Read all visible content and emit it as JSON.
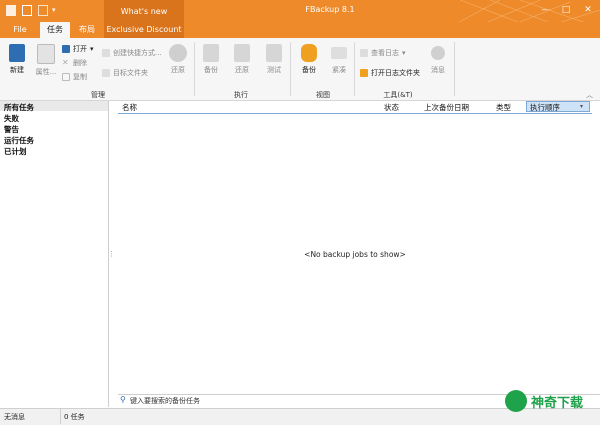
{
  "window": {
    "title": "FBackup 8.1",
    "minimize": "—",
    "maximize": "□",
    "close": "✕"
  },
  "tabs": {
    "file": "File",
    "task": "任务",
    "layout": "布局",
    "whats_new": "What's new",
    "discount": "Exclusive Discount"
  },
  "ribbon": {
    "manage": {
      "caption": "管理",
      "new": "新建",
      "properties": "属性...",
      "open": "打开",
      "delete": "删除",
      "copy": "复制",
      "create_shortcut": "创建快捷方式...",
      "target_folder": "目标文件夹",
      "restore": "还原"
    },
    "execute": {
      "caption": "执行",
      "backup": "备份",
      "restore": "还原",
      "test": "测试"
    },
    "view": {
      "caption": "视图",
      "backup": "备份",
      "compact": "紧凑"
    },
    "tools": {
      "caption": "工具(&T)",
      "view_log": "查看日志",
      "open_log_folder": "打开日志文件夹",
      "messages": "消息"
    }
  },
  "nav": [
    "所有任务",
    "失败",
    "警告",
    "运行任务",
    "已计划"
  ],
  "columns": [
    "名称",
    "状态",
    "上次备份日期",
    "类型",
    "执行顺序"
  ],
  "empty_message": "<No backup jobs to show>",
  "search": {
    "placeholder": "键入要搜索的备份任务"
  },
  "status": {
    "messages": "无消息",
    "task_count": "0 任务"
  },
  "watermark": {
    "text": "神奇下载"
  },
  "colors": {
    "accent": "#ee8a2a",
    "accent_dark": "#d9741c",
    "new_icon": "#2f6db3",
    "view_icon": "#f0a020"
  }
}
